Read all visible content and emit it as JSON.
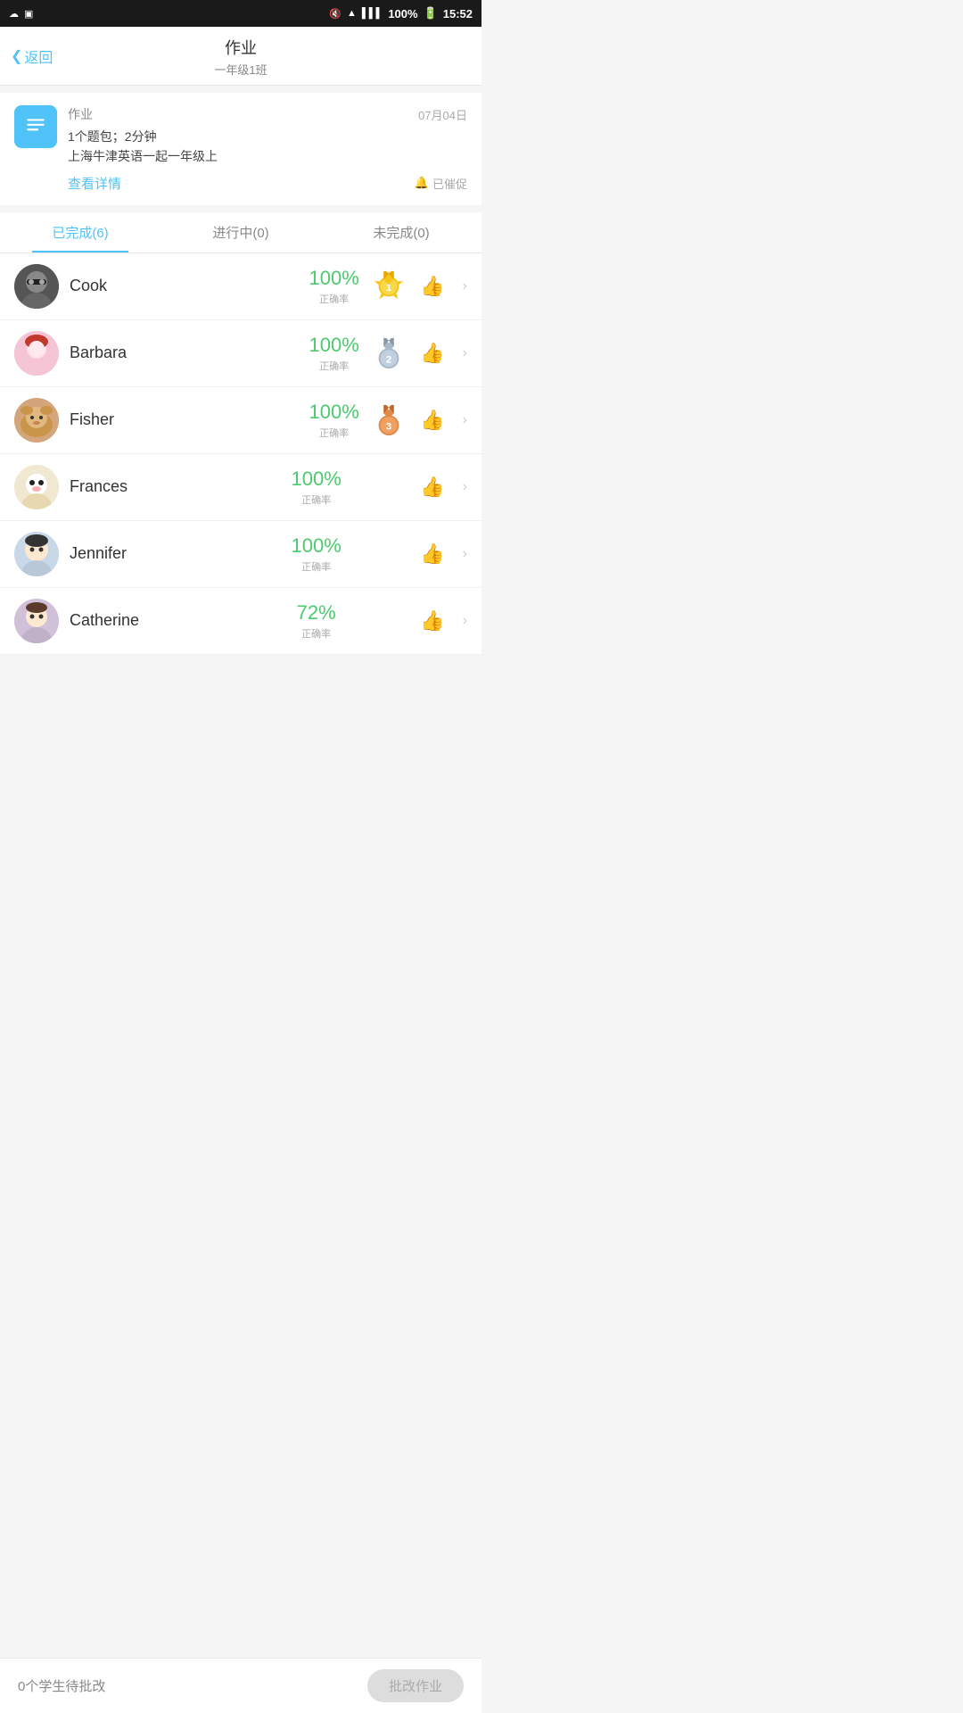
{
  "status": {
    "time": "15:52",
    "battery": "100%",
    "signal": "full"
  },
  "header": {
    "back_label": "返回",
    "title": "作业",
    "subtitle": "一年级1班"
  },
  "assignment": {
    "label": "作业",
    "date": "07月04日",
    "desc_line1": "1个题包；2分钟",
    "desc_line2": "上海牛津英语一起一年级上",
    "view_detail": "查看详情",
    "urge_label": "已催促"
  },
  "tabs": [
    {
      "id": "completed",
      "label": "已完成(6)",
      "active": true
    },
    {
      "id": "ongoing",
      "label": "进行中(0)",
      "active": false
    },
    {
      "id": "incomplete",
      "label": "未完成(0)",
      "active": false
    }
  ],
  "students": [
    {
      "id": "cook",
      "name": "Cook",
      "score": "100%",
      "score_label": "正确率",
      "rank": 1,
      "avatar_emoji": "🕶"
    },
    {
      "id": "barbara",
      "name": "Barbara",
      "score": "100%",
      "score_label": "正确率",
      "rank": 2,
      "avatar_emoji": "👧"
    },
    {
      "id": "fisher",
      "name": "Fisher",
      "score": "100%",
      "score_label": "正确率",
      "rank": 3,
      "avatar_emoji": "🐶"
    },
    {
      "id": "frances",
      "name": "Frances",
      "score": "100%",
      "score_label": "正确率",
      "rank": 0,
      "avatar_emoji": "🤖"
    },
    {
      "id": "jennifer",
      "name": "Jennifer",
      "score": "100%",
      "score_label": "正确率",
      "rank": 0,
      "avatar_emoji": "👶"
    },
    {
      "id": "catherine",
      "name": "Catherine",
      "score": "72%",
      "score_label": "正确率",
      "rank": 0,
      "avatar_emoji": "🧒"
    }
  ],
  "footer": {
    "pending_text": "0个学生待批改",
    "grade_btn": "批改作业"
  },
  "colors": {
    "primary": "#4fc3f7",
    "green": "#4cca6e",
    "gold": "#f5c518",
    "silver": "#a8b8c8",
    "bronze": "#e0894a"
  }
}
